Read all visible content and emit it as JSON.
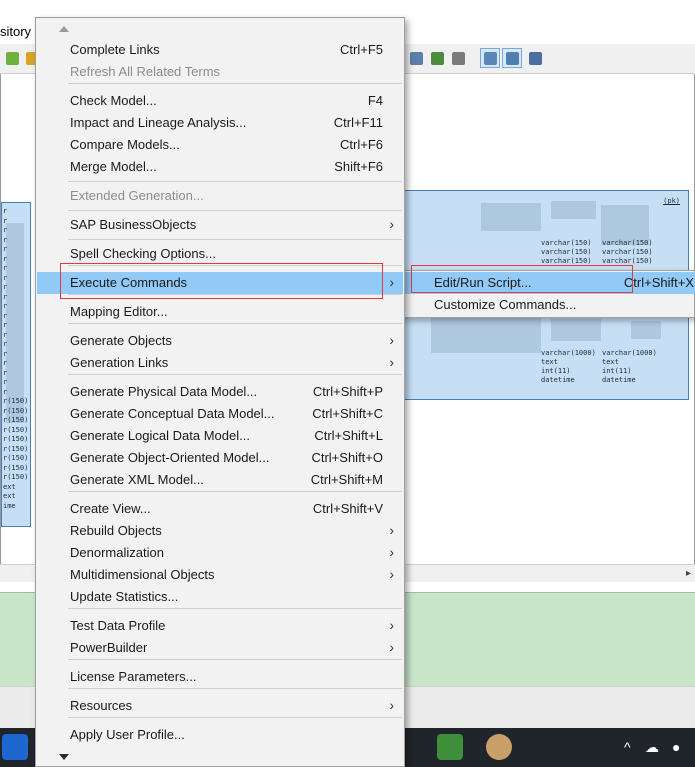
{
  "background": {
    "menubar_fragment": "sitory",
    "entity_right": {
      "pk_label": "(pk)",
      "column_types_a": [
        "varchar(150)",
        "varchar(150)",
        "varchar(150)",
        "varchar(1000)",
        "text",
        "int(11)",
        "datetime"
      ],
      "column_types_b": [
        "varchar(150)",
        "varchar(150)",
        "varchar(150)",
        "varchar(1000)",
        "text",
        "int(11)",
        "datetime"
      ]
    },
    "entity_left": {
      "column_types": [
        "r",
        "r",
        "r",
        "r",
        "r",
        "r",
        "r",
        "r",
        "r",
        "r",
        "r",
        "r",
        "r",
        "r",
        "r",
        "r",
        "r",
        "r",
        "r",
        "r",
        "r(150)",
        "r(150)",
        "r(150)",
        "r(150)",
        "r(150)",
        "r(150)",
        "r(150)",
        "r(150)",
        "r(150)",
        "ext",
        "ext",
        "ime"
      ]
    }
  },
  "context_menu": {
    "items": [
      {
        "label": "Complete Links",
        "shortcut": "Ctrl+F5"
      },
      {
        "label": "Refresh All Related Terms",
        "shortcut": "",
        "disabled": true
      },
      {
        "label": "Check Model...",
        "shortcut": "F4"
      },
      {
        "label": "Impact and Lineage Analysis...",
        "shortcut": "Ctrl+F11"
      },
      {
        "label": "Compare Models...",
        "shortcut": "Ctrl+F6"
      },
      {
        "label": "Merge Model...",
        "shortcut": "Shift+F6"
      },
      {
        "label": "Extended Generation...",
        "shortcut": "",
        "disabled": true
      },
      {
        "label": "SAP BusinessObjects",
        "shortcut": ""
      },
      {
        "label": "Spell Checking Options...",
        "shortcut": ""
      },
      {
        "label": "Execute Commands",
        "shortcut": ""
      },
      {
        "label": "Mapping Editor...",
        "shortcut": ""
      },
      {
        "label": "Generate Objects",
        "shortcut": ""
      },
      {
        "label": "Generation Links",
        "shortcut": ""
      },
      {
        "label": "Generate Physical Data Model...",
        "shortcut": "Ctrl+Shift+P"
      },
      {
        "label": "Generate Conceptual Data Model...",
        "shortcut": "Ctrl+Shift+C"
      },
      {
        "label": "Generate Logical Data Model...",
        "shortcut": "Ctrl+Shift+L"
      },
      {
        "label": "Generate Object-Oriented Model...",
        "shortcut": "Ctrl+Shift+O"
      },
      {
        "label": "Generate XML Model...",
        "shortcut": "Ctrl+Shift+M"
      },
      {
        "label": "Create View...",
        "shortcut": "Ctrl+Shift+V"
      },
      {
        "label": "Rebuild Objects",
        "shortcut": ""
      },
      {
        "label": "Denormalization",
        "shortcut": ""
      },
      {
        "label": "Multidimensional Objects",
        "shortcut": ""
      },
      {
        "label": "Update Statistics...",
        "shortcut": ""
      },
      {
        "label": "Test Data Profile",
        "shortcut": ""
      },
      {
        "label": "PowerBuilder",
        "shortcut": ""
      },
      {
        "label": "License Parameters...",
        "shortcut": ""
      },
      {
        "label": "Resources",
        "shortcut": ""
      },
      {
        "label": "Apply User Profile...",
        "shortcut": ""
      }
    ],
    "submenu_arrow": "›"
  },
  "submenu": {
    "items": [
      {
        "label": "Edit/Run Script...",
        "shortcut": "Ctrl+Shift+X"
      },
      {
        "label": "Customize Commands...",
        "shortcut": ""
      }
    ]
  },
  "colors": {
    "highlight": "#91c9f7",
    "annotation_red": "#e03a3a",
    "entity_fill": "#c7dff5",
    "output_pane": "#c9e6cb"
  }
}
